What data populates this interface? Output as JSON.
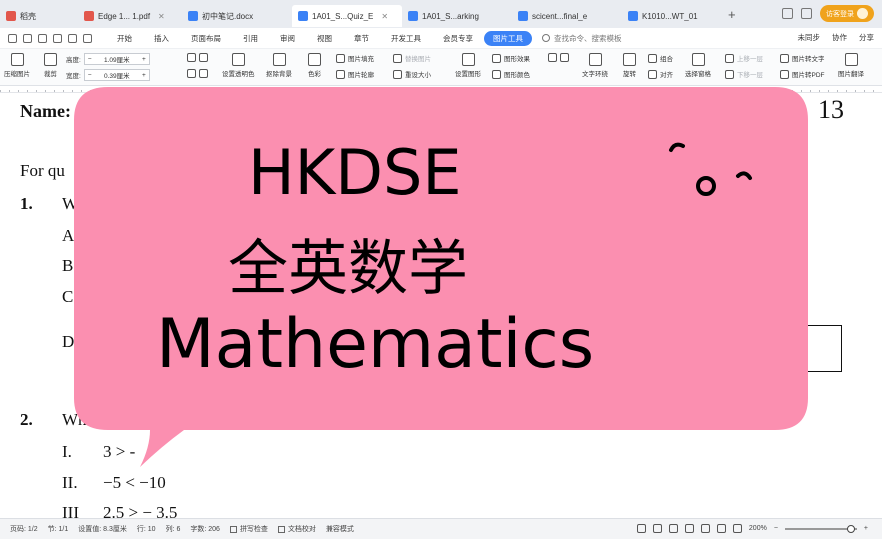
{
  "tabs": {
    "home": "稻壳",
    "items": [
      {
        "label": "Edge 1... 1.pdf",
        "color": "#e2574c"
      },
      {
        "label": "初中笔记.docx",
        "color": "#3b82f6"
      },
      {
        "label": "1A01_S...Quiz_E",
        "color": "#3b82f6"
      },
      {
        "label": "1A01_S...arking",
        "color": "#3b82f6"
      },
      {
        "label": "scicent...final_e",
        "color": "#3b82f6"
      },
      {
        "label": "K1010...WT_01",
        "color": "#3b82f6"
      }
    ],
    "add": "+",
    "login": "访客登录"
  },
  "menu": {
    "items": [
      "开始",
      "插入",
      "页面布局",
      "引用",
      "审阅",
      "视图",
      "章节",
      "开发工具",
      "会员专享"
    ],
    "active": "图片工具",
    "search": "查找命令、搜索模板",
    "right": [
      "未同步",
      "协作",
      "分享"
    ]
  },
  "ribbon": {
    "compress": "压缩图片",
    "crop": "裁剪",
    "height_label": "高度:",
    "height_value": "1.09厘米",
    "width_label": "宽度:",
    "width_value": "0.39厘米",
    "transparent": "设置透明色",
    "remove_bg": "抠除背景",
    "color": "色彩",
    "fill": "图片填充",
    "outline": "图片轮廓",
    "replace": "替换图片",
    "reset_size": "重设大小",
    "reset_pic": "设置图形",
    "effect": "图形效果",
    "graphic_color": "图形颜色",
    "wrap": "文字环绕",
    "rotate": "旋转",
    "align": "对齐",
    "group": "组合",
    "select_pane": "选择窗格",
    "up": "上移一层",
    "down": "下移一层",
    "to_text": "图片转文字",
    "to_pdf": "图片转PDF",
    "translate": "图片翻译"
  },
  "document": {
    "name_label": "Name:",
    "page_num": "13",
    "for_qu": "For qu",
    "q1": "1.",
    "q1_w": "W",
    "opt_a": "A",
    "opt_b": "B",
    "opt_c": "C",
    "opt_d": "D",
    "q2": "2.",
    "q2_text": "Whi",
    "roman_1": "I.",
    "roman_1_expr": "3 > -",
    "roman_2": "II.",
    "roman_2_expr": "−5 < −10",
    "roman_3": "III",
    "roman_3_expr": "2.5 > − 3.5",
    "hand_mark": "◠o◠"
  },
  "overlay": {
    "line1": "HKDSE",
    "line2": "全英数学",
    "line3": "Mathematics",
    "bubble_color": "#fb8fb0"
  },
  "status": {
    "page": "页码: 1/2",
    "section": "节: 1/1",
    "set": "设置值: 8.3厘米",
    "row": "行: 10",
    "col": "列: 6",
    "words": "字数: 206",
    "spell": "拼写检查",
    "proof": "文档校对",
    "compat": "兼容模式",
    "zoom": "200%"
  }
}
